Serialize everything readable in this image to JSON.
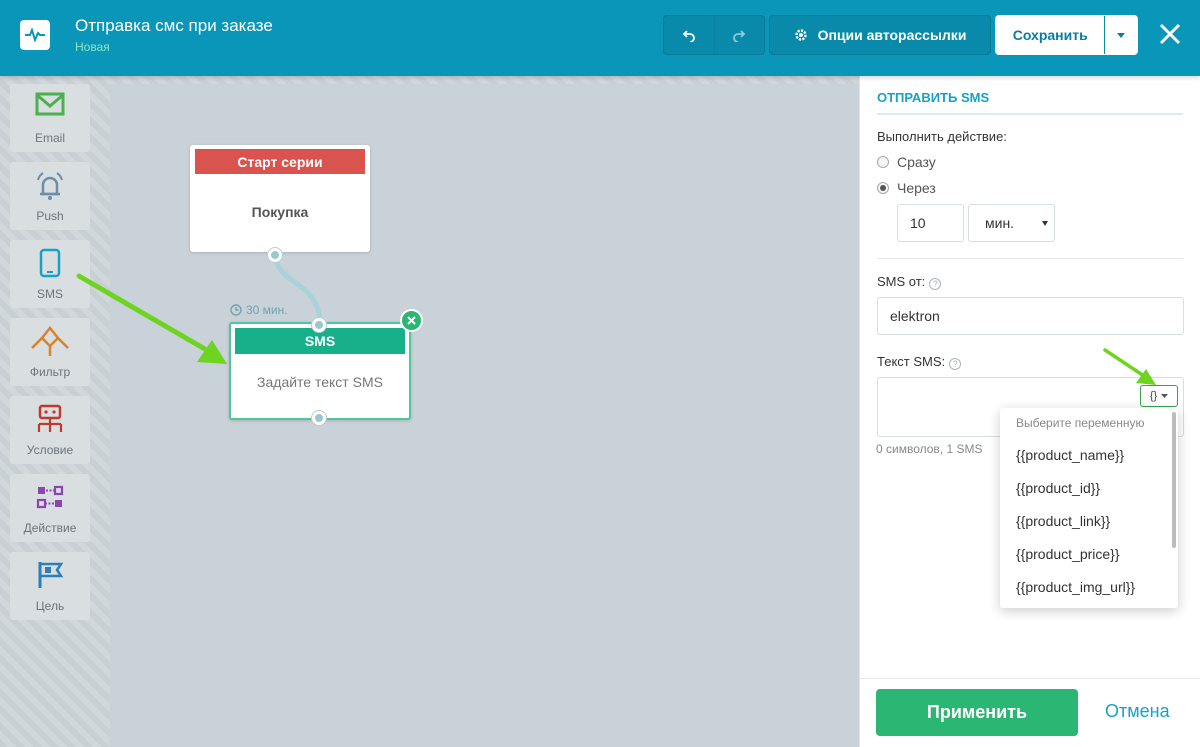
{
  "header": {
    "title": "Отправка смс при заказе",
    "status": "Новая",
    "options_label": "Опции авторассылки",
    "save_label": "Сохранить"
  },
  "toolbox": {
    "items": [
      {
        "label": "Email",
        "icon": "envelope-icon",
        "color": "#4caf50"
      },
      {
        "label": "Push",
        "icon": "bell-icon",
        "color": "#6c8ea8"
      },
      {
        "label": "SMS",
        "icon": "phone-icon",
        "color": "#17a2c4"
      },
      {
        "label": "Фильтр",
        "icon": "filter-icon",
        "color": "#d9822b"
      },
      {
        "label": "Условие",
        "icon": "condition-icon",
        "color": "#c0392b"
      },
      {
        "label": "Действие",
        "icon": "action-icon",
        "color": "#8e44ad"
      },
      {
        "label": "Цель",
        "icon": "flag-icon",
        "color": "#2c7fb8"
      }
    ]
  },
  "canvas": {
    "start_node": {
      "header": "Старт серии",
      "body": "Покупка"
    },
    "delay_label": "30 мин.",
    "sms_node": {
      "header": "SMS",
      "body": "Задайте текст SMS"
    }
  },
  "panel": {
    "title": "ОТПРАВИТЬ SMS",
    "execute_label": "Выполнить действие:",
    "option_immediate": "Сразу",
    "option_after": "Через",
    "delay_value": "10",
    "delay_unit": "мин.",
    "sms_from_label": "SMS от:",
    "sms_from_value": "elektron",
    "sms_text_label": "Текст SMS:",
    "counter": "0 символов, 1 SMS",
    "variables_header": "Выберите переменную",
    "variables": [
      "{{product_name}}",
      "{{product_id}}",
      "{{product_link}}",
      "{{product_price}}",
      "{{product_img_url}}"
    ],
    "apply_label": "Применить",
    "cancel_label": "Отмена"
  },
  "colors": {
    "topbar": "#0996b8",
    "accent_green": "#2bb673",
    "start_red": "#d9534f",
    "sms_teal": "#17b08a"
  }
}
